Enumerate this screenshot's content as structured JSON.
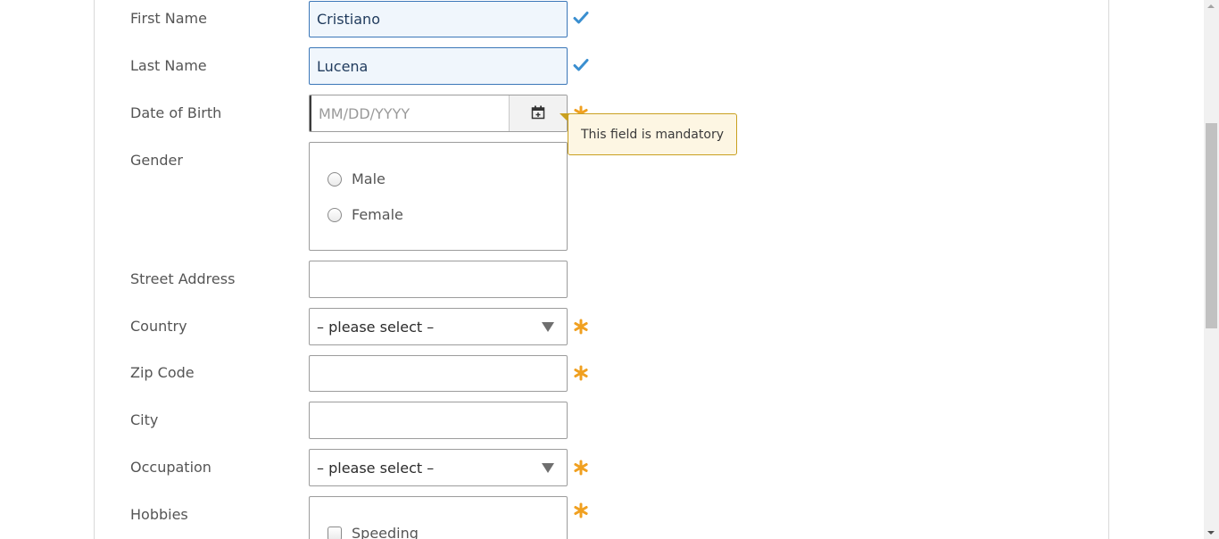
{
  "form": {
    "first_name": {
      "label": "First Name",
      "value": "Cristiano"
    },
    "last_name": {
      "label": "Last Name",
      "value": "Lucena"
    },
    "dob": {
      "label": "Date of Birth",
      "placeholder": "MM/DD/YYYY",
      "tooltip": "This field is mandatory"
    },
    "gender": {
      "label": "Gender",
      "options": [
        "Male",
        "Female"
      ]
    },
    "street": {
      "label": "Street Address",
      "value": ""
    },
    "country": {
      "label": "Country",
      "selected": "– please select –"
    },
    "zip": {
      "label": "Zip Code",
      "value": ""
    },
    "city": {
      "label": "City",
      "value": ""
    },
    "occupation": {
      "label": "Occupation",
      "selected": "– please select –"
    },
    "hobbies": {
      "label": "Hobbies",
      "options": [
        "Speeding"
      ]
    }
  },
  "colors": {
    "valid_check": "#3a8fd0",
    "required_star": "#f0a020",
    "tooltip_bg": "#fdf6e3",
    "tooltip_border": "#c9a020"
  },
  "icons": {
    "valid": "checkmark-icon",
    "required": "asterisk-icon",
    "calendar": "calendar-icon"
  }
}
